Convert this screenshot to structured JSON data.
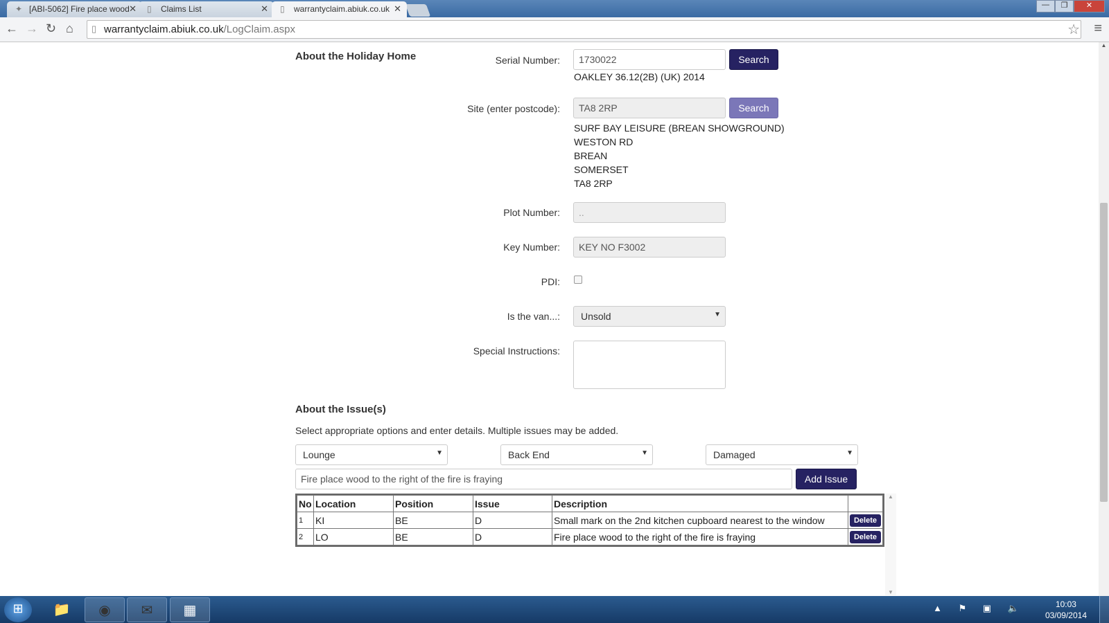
{
  "browser": {
    "tabs": [
      {
        "label": "[ABI-5062] Fire place wood",
        "icon": "jira-icon"
      },
      {
        "label": "Claims List",
        "icon": "page-icon"
      },
      {
        "label": "warrantyclaim.abiuk.co.uk",
        "icon": "page-icon",
        "active": true
      }
    ],
    "url_host": "warrantyclaim.abiuk.co.uk",
    "url_path": "/LogClaim.aspx"
  },
  "holiday_home": {
    "heading": "About the Holiday Home",
    "serial_label": "Serial Number:",
    "serial_value": "1730022",
    "serial_search": "Search",
    "model": "OAKLEY 36.12(2B) (UK) 2014",
    "site_label": "Site (enter postcode):",
    "site_value": "TA8 2RP",
    "site_search": "Search",
    "address": [
      "SURF BAY LEISURE (BREAN SHOWGROUND)",
      "WESTON RD",
      "BREAN",
      "SOMERSET",
      "TA8 2RP"
    ],
    "plot_label": "Plot Number:",
    "plot_value": "..",
    "key_label": "Key Number:",
    "key_value": "KEY NO F3002",
    "pdi_label": "PDI:",
    "pdi_checked": false,
    "van_label": "Is the van...:",
    "van_value": "Unsold",
    "special_label": "Special Instructions:",
    "special_value": ""
  },
  "issues": {
    "heading": "About the Issue(s)",
    "instructions": "Select appropriate options and enter details. Multiple issues may be added.",
    "location": "Lounge",
    "position": "Back End",
    "issue": "Damaged",
    "description": "Fire place wood to the right of the fire is fraying",
    "add_label": "Add Issue",
    "columns": [
      "No",
      "Location",
      "Position",
      "Issue",
      "Description",
      ""
    ],
    "rows": [
      [
        "1",
        "KI",
        "BE",
        "D",
        "Small mark on the 2nd kitchen cupboard nearest to the window",
        "Delete"
      ],
      [
        "2",
        "LO",
        "BE",
        "D",
        "Fire place wood to the right of the fire is fraying",
        "Delete"
      ]
    ]
  },
  "taskbar": {
    "time": "10:03",
    "date": "03/09/2014"
  },
  "colors": {
    "primary_button": "#262262",
    "disabled_button": "#7b77b8"
  }
}
